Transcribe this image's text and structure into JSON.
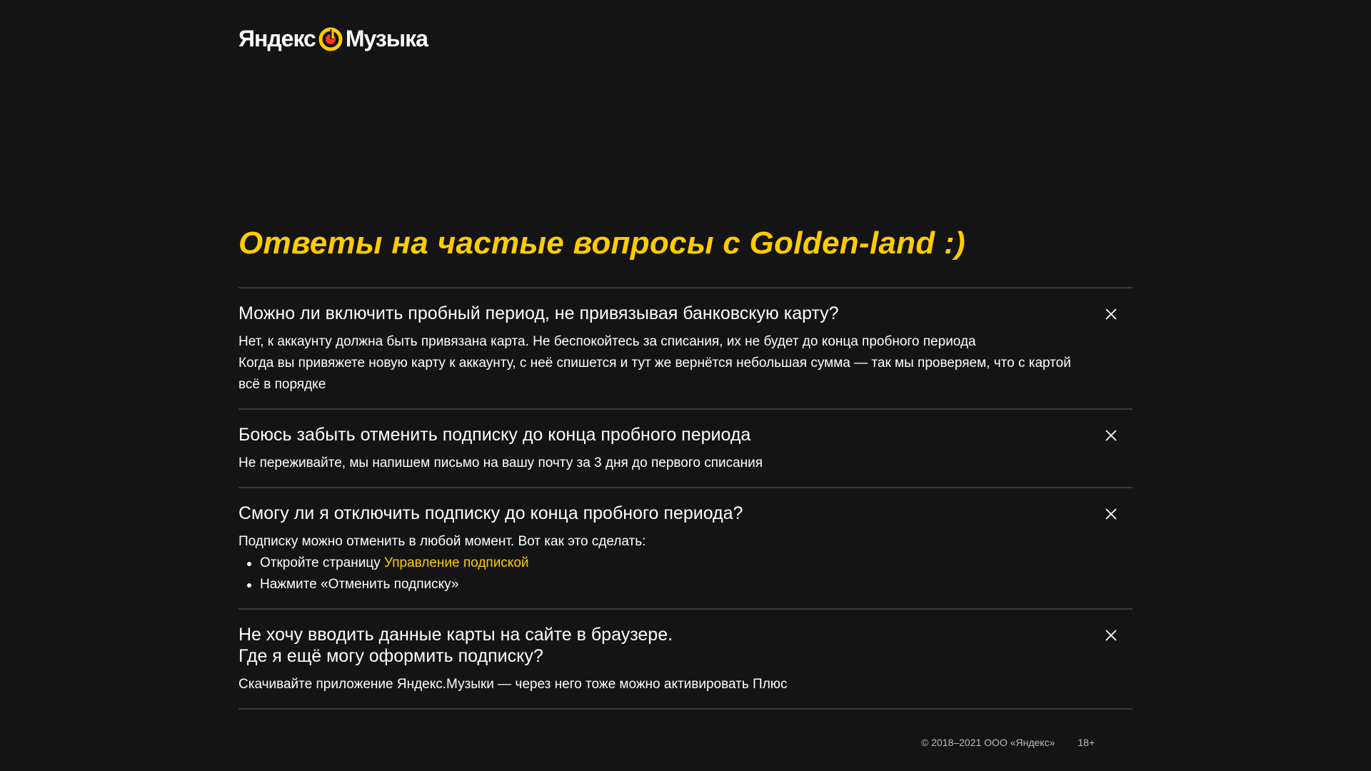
{
  "header": {
    "logo_left": "Яндекс",
    "logo_right": "Музыка",
    "logo_icon": "yandex-music-icon",
    "accent_color": "#ffcc00"
  },
  "faq": {
    "title": "Ответы на частые вопросы с Golden-land :)",
    "close_icon": "close-icon",
    "items": [
      {
        "question": "Можно ли включить пробный период, не привязывая банковскую карту?",
        "answer_p1": "Нет, к аккаунту должна быть привязана карта. Не беспокойтесь за списания, их не будет до конца пробного периода",
        "answer_p2": "Когда вы привяжете новую карту к аккаунту, с неё спишется и тут же вернётся небольшая сумма — так мы проверяем, что с картой всё в порядке"
      },
      {
        "question": "Боюсь забыть отменить подписку до конца пробного периода",
        "answer_p1": "Не переживайте, мы напишем письмо на вашу почту за 3 дня до первого списания"
      },
      {
        "question": "Смогу ли я отключить подписку до конца пробного периода?",
        "answer_p1": "Подписку можно отменить в любой момент. Вот как это сделать:",
        "step1_text": "Откройте страницу ",
        "step1_link": "Управление подпиской",
        "step2_text": "Нажмите «Отменить подписку»"
      },
      {
        "question_line1": "Не хочу вводить данные карты на сайте в браузере.",
        "question_line2": "Где я ещё могу оформить подписку?",
        "answer_p1": "Скачивайте приложение Яндекс.Музыки — через него тоже можно активировать Плюс"
      }
    ]
  },
  "footer": {
    "copyright": "© 2018–2021 ООО «Яндекс»",
    "age": "18+"
  }
}
